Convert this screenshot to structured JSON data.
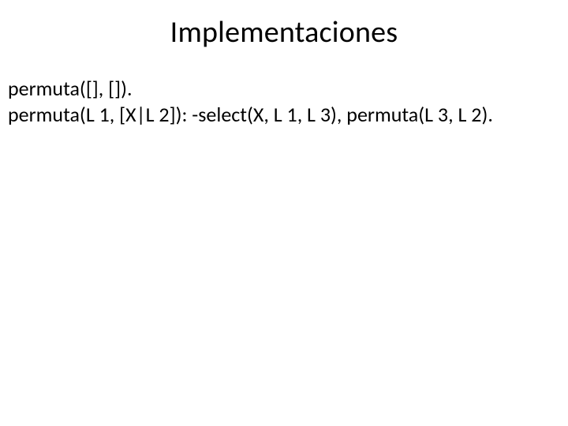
{
  "slide": {
    "title": "Implementaciones",
    "code": {
      "line1": "permuta([], []).",
      "line2": "permuta(L 1, [X|L 2]): -select(X, L 1, L 3), permuta(L 3, L 2)."
    }
  }
}
